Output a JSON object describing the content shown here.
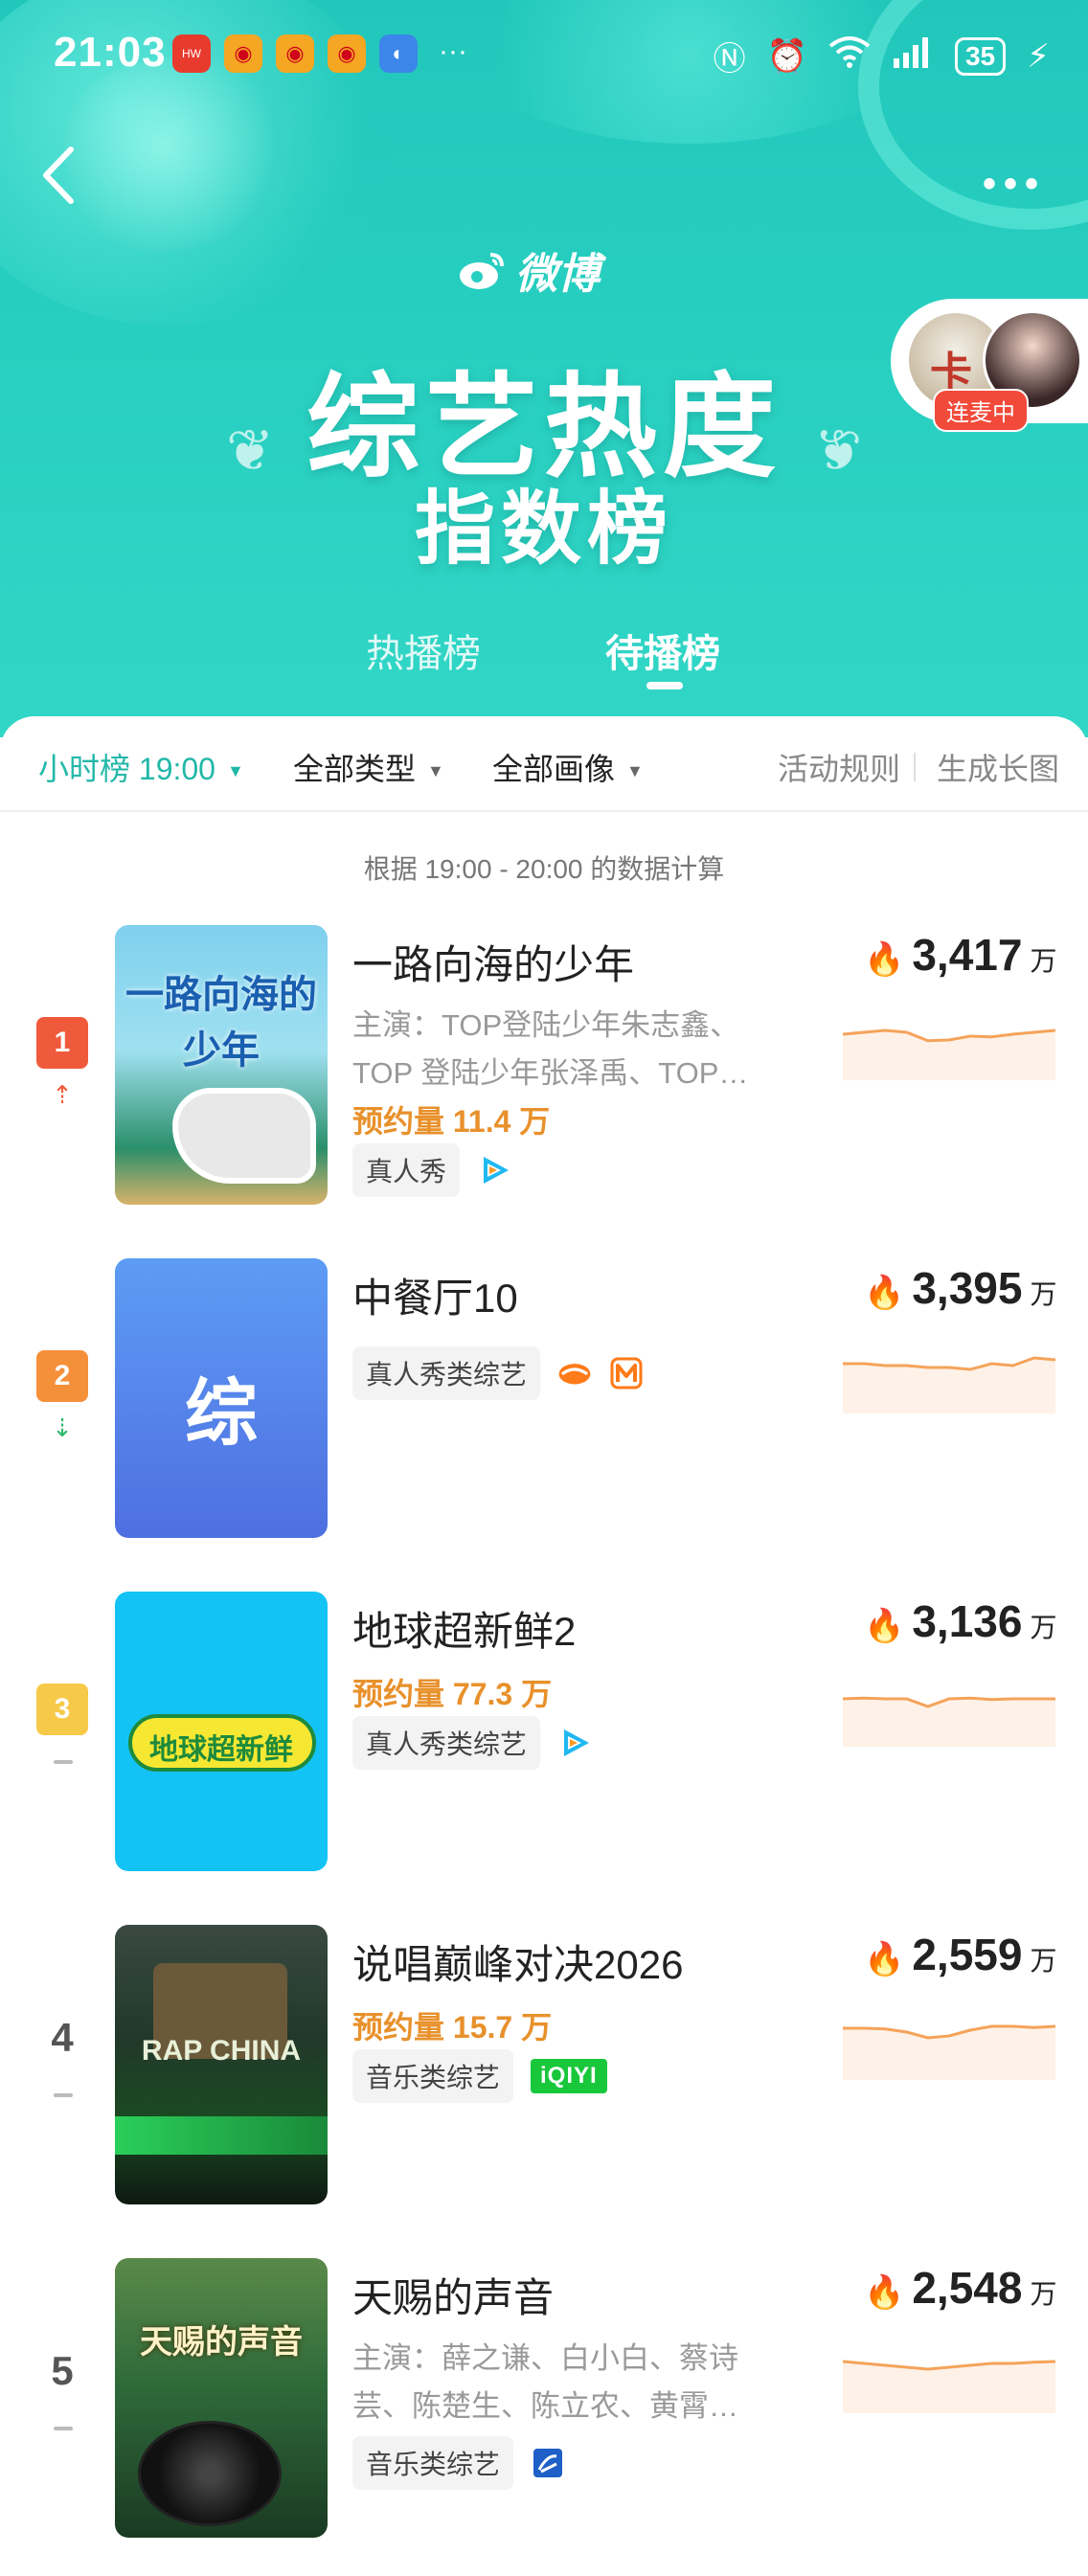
{
  "status_bar": {
    "time": "21:03",
    "apps": [
      "huawei-app-icon",
      "weibo-icon",
      "weibo-icon",
      "weibo-icon",
      "browser-icon"
    ],
    "more": "···",
    "battery": "35",
    "icons": [
      "nfc-icon",
      "alarm-icon",
      "wifi-icon",
      "signal-icon",
      "battery-icon",
      "charging-icon"
    ]
  },
  "header": {
    "brand": "微博",
    "title": "综艺热度",
    "subtitle": "指数榜",
    "live_badge": "连麦中",
    "tabs": [
      {
        "label": "热播榜",
        "active": false
      },
      {
        "label": "待播榜",
        "active": true
      }
    ]
  },
  "filters": {
    "time": "小时榜 19:00",
    "type": "全部类型",
    "image": "全部画像",
    "rules": "活动规则",
    "long_image": "生成长图"
  },
  "calc_note": "根据 19:00 - 20:00 的数据计算",
  "colors": {
    "accent": "#22b8a8",
    "rank1": "#f05a3c",
    "rank2": "#f5903a",
    "rank3": "#f7c948",
    "reserve": "#e8912c",
    "spark": "#f5a35a"
  },
  "list": [
    {
      "rank": "1",
      "trend": "up",
      "title": "一路向海的少年",
      "cast": "主演：TOP登陆少年朱志鑫、TOP 登陆少年张泽禹、TOP…",
      "reserve": "预约量 11.4 万",
      "tag": "真人秀",
      "platforms": [
        "tencent-video-icon"
      ],
      "heat": "3,417",
      "unit": "万",
      "poster_text": "一路向海的少年",
      "spark": [
        0.55,
        0.5,
        0.45,
        0.5,
        0.72,
        0.7,
        0.6,
        0.62,
        0.55,
        0.5,
        0.45
      ]
    },
    {
      "rank": "2",
      "trend": "down",
      "title": "中餐厅10",
      "cast": "",
      "reserve": "",
      "tag": "真人秀类综艺",
      "platforms": [
        "mango-tv-icon",
        "mgtv-icon"
      ],
      "heat": "3,395",
      "unit": "万",
      "poster_text": "综",
      "spark": [
        0.45,
        0.45,
        0.5,
        0.5,
        0.55,
        0.55,
        0.6,
        0.45,
        0.5,
        0.3,
        0.35
      ]
    },
    {
      "rank": "3",
      "trend": "flat",
      "title": "地球超新鲜2",
      "cast": "",
      "reserve": "预约量 77.3 万",
      "tag": "真人秀类综艺",
      "platforms": [
        "tencent-video-icon"
      ],
      "heat": "3,136",
      "unit": "万",
      "poster_text": "地球超新鲜",
      "spark": [
        0.5,
        0.48,
        0.5,
        0.5,
        0.7,
        0.5,
        0.48,
        0.52,
        0.5,
        0.5,
        0.5
      ]
    },
    {
      "rank": "4",
      "trend": "flat",
      "title": "说唱巅峰对决2026",
      "cast": "",
      "reserve": "预约量 15.7 万",
      "tag": "音乐类综艺",
      "platforms": [
        "iqiyi-icon"
      ],
      "platform_label": "iQIYI",
      "heat": "2,559",
      "unit": "万",
      "poster_text": "RAP CHINA",
      "spark": [
        0.4,
        0.4,
        0.42,
        0.5,
        0.65,
        0.6,
        0.45,
        0.35,
        0.35,
        0.38,
        0.35
      ]
    },
    {
      "rank": "5",
      "trend": "flat",
      "title": "天赐的声音",
      "cast": "主演：薛之谦、白小白、蔡诗芸、陈楚生、陈立农、黄霄…",
      "reserve": "",
      "tag": "音乐类综艺",
      "platforms": [
        "zhejiang-tv-icon"
      ],
      "heat": "2,548",
      "unit": "万",
      "poster_text": "天赐的声音",
      "spark": [
        0.4,
        0.45,
        0.5,
        0.55,
        0.6,
        0.55,
        0.5,
        0.45,
        0.45,
        0.42,
        0.4
      ]
    }
  ]
}
